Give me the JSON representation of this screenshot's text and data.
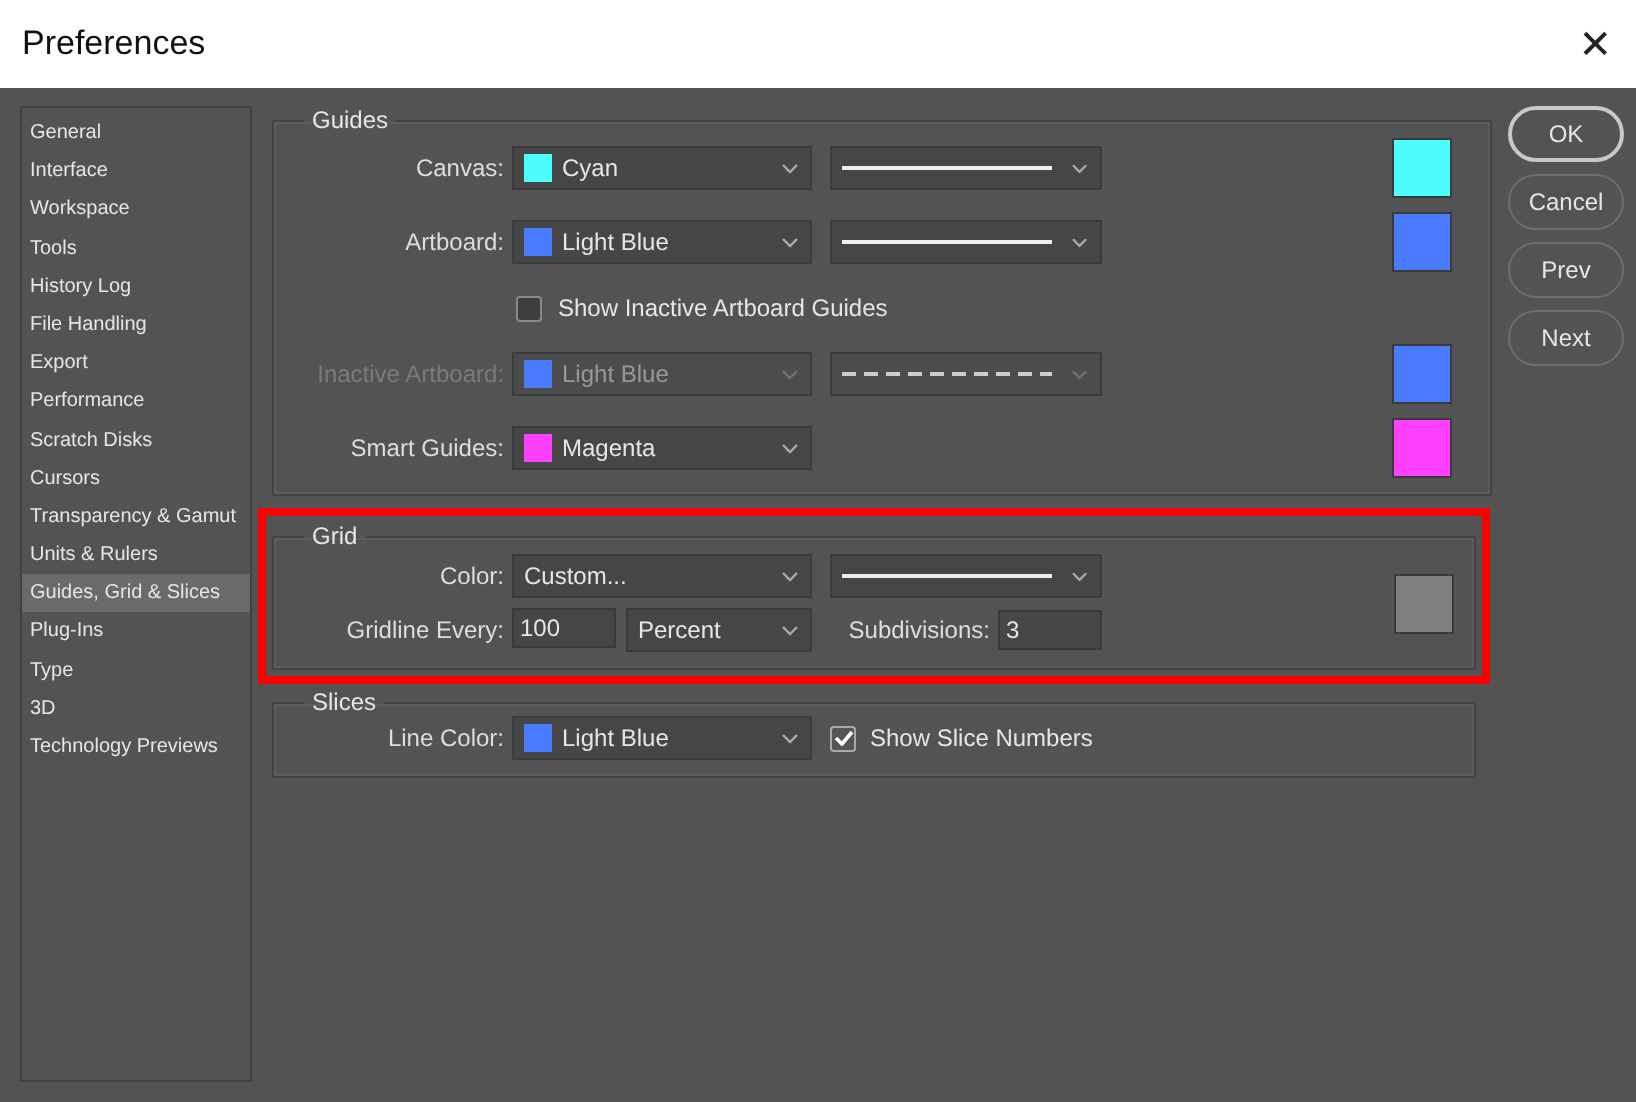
{
  "window": {
    "title": "Preferences",
    "close": "✕"
  },
  "sidebar": {
    "items": [
      {
        "label": "General",
        "selected": false
      },
      {
        "label": "Interface",
        "selected": false
      },
      {
        "label": "Workspace",
        "selected": false
      },
      {
        "label": "Tools",
        "selected": false
      },
      {
        "label": "History Log",
        "selected": false
      },
      {
        "label": "File Handling",
        "selected": false
      },
      {
        "label": "Export",
        "selected": false
      },
      {
        "label": "Performance",
        "selected": false
      },
      {
        "label": "Scratch Disks",
        "selected": false
      },
      {
        "label": "Cursors",
        "selected": false
      },
      {
        "label": "Transparency & Gamut",
        "selected": false
      },
      {
        "label": "Units & Rulers",
        "selected": false
      },
      {
        "label": "Guides, Grid & Slices",
        "selected": true
      },
      {
        "label": "Plug-Ins",
        "selected": false
      },
      {
        "label": "Type",
        "selected": false
      },
      {
        "label": "3D",
        "selected": false
      },
      {
        "label": "Technology Previews",
        "selected": false
      }
    ]
  },
  "guides": {
    "title": "Guides",
    "rows": [
      {
        "kind": "color",
        "label": "Canvas:",
        "value": "Cyan",
        "color": "#4dfcfc",
        "dashed": false,
        "disabled": false
      },
      {
        "kind": "color",
        "label": "Artboard:",
        "value": "Light Blue",
        "color": "#4a7bff",
        "dashed": false,
        "disabled": false
      },
      {
        "kind": "checkbox",
        "label": "Show Inactive Artboard Guides",
        "checked": false
      },
      {
        "kind": "color",
        "label": "Inactive Artboard:",
        "value": "Light Blue",
        "color": "#4a7bff",
        "dashed": true,
        "disabled": true
      },
      {
        "kind": "color",
        "label": "Smart Guides:",
        "value": "Magenta",
        "color": "#ff40ff",
        "disabled": false
      }
    ]
  },
  "grid": {
    "title": "Grid",
    "highlighted": true,
    "color": {
      "label": "Color:",
      "value": "Custom...",
      "dashed": false,
      "color": "#7f7f7f"
    },
    "gridline": {
      "label": "Gridline Every:",
      "value": "100",
      "unit": "Percent"
    },
    "subdivisions": {
      "label": "Subdivisions:",
      "value": "3"
    }
  },
  "slices": {
    "title": "Slices",
    "line_color": {
      "label": "Line Color:",
      "value": "Light Blue",
      "color": "#4a7bff"
    },
    "show_numbers": {
      "label": "Show Slice Numbers",
      "checked": true
    }
  },
  "buttons": [
    {
      "label": "OK",
      "default": true
    },
    {
      "label": "Cancel",
      "default": false
    },
    {
      "label": "Prev",
      "default": false
    },
    {
      "label": "Next",
      "default": false
    }
  ]
}
